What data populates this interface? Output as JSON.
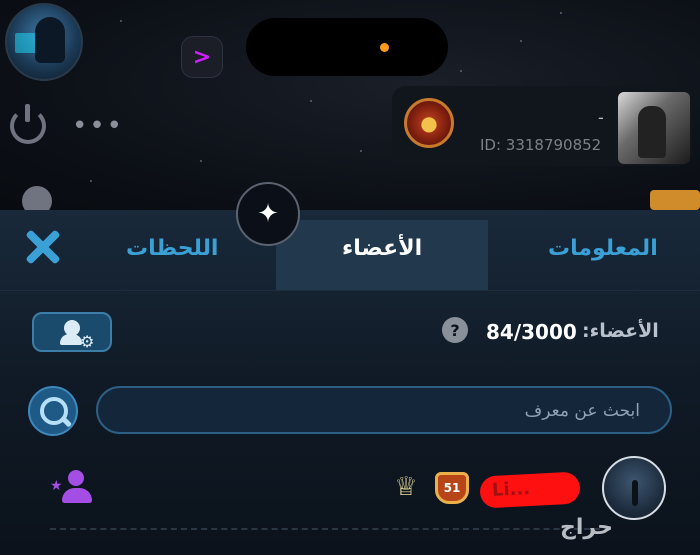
{
  "header": {
    "profile_name": "-",
    "profile_id": "ID: 3318790852"
  },
  "tabs": [
    {
      "label": "المعلومات",
      "active": false
    },
    {
      "label": "الأعضاء",
      "active": true
    },
    {
      "label": "اللحظات",
      "active": false
    }
  ],
  "members": {
    "label": "الأعضاء:",
    "count": "84/3000",
    "search_placeholder": "ابحث عن معرف"
  },
  "member_row": {
    "level": "51",
    "name": "Li..."
  },
  "watermark": "حراج",
  "colors": {
    "accent": "#3aa0d6",
    "active_tab_bg": "#22384d",
    "invite_purple": "#a44ee6",
    "status_dot": "#ff9a1f"
  }
}
